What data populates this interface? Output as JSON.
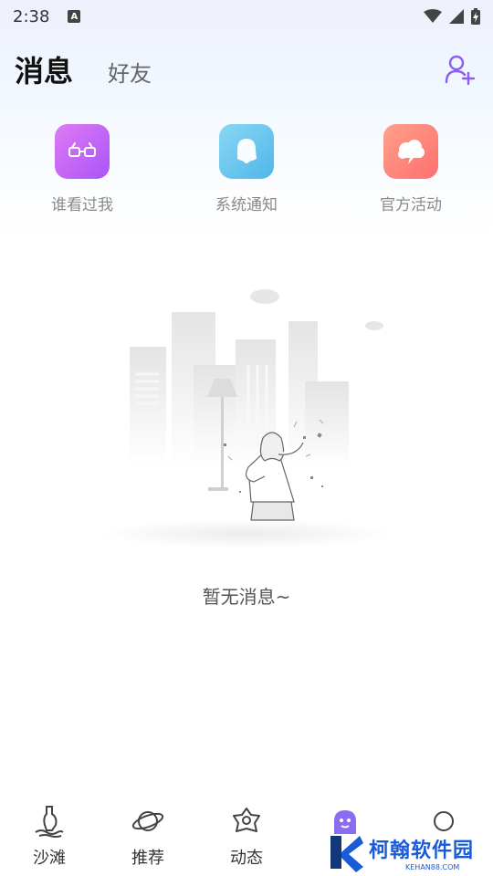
{
  "status_bar": {
    "time": "2:38",
    "notification_icon": "A"
  },
  "header": {
    "active_tab": "消息",
    "inactive_tab": "好友",
    "add_friend_icon": "add-user-icon"
  },
  "quick_actions": [
    {
      "label": "谁看过我",
      "icon": "glasses-icon",
      "color": "#c86cf0"
    },
    {
      "label": "系统通知",
      "icon": "bell-icon",
      "color": "#68c8ee"
    },
    {
      "label": "官方活动",
      "icon": "cloud-icon",
      "color": "#ff8a78"
    }
  ],
  "empty_state": {
    "text": "暂无消息~"
  },
  "bottom_nav": [
    {
      "label": "沙滩",
      "icon": "beach-bottle-icon"
    },
    {
      "label": "推荐",
      "icon": "planet-icon"
    },
    {
      "label": "动态",
      "icon": "flower-icon"
    },
    {
      "label": "",
      "icon": "ghost-icon",
      "color": "#8b6df0"
    },
    {
      "label": "",
      "icon": "profile-icon"
    }
  ],
  "watermark": {
    "main": "柯翰软件园",
    "sub": "KEHAN88.COM"
  }
}
